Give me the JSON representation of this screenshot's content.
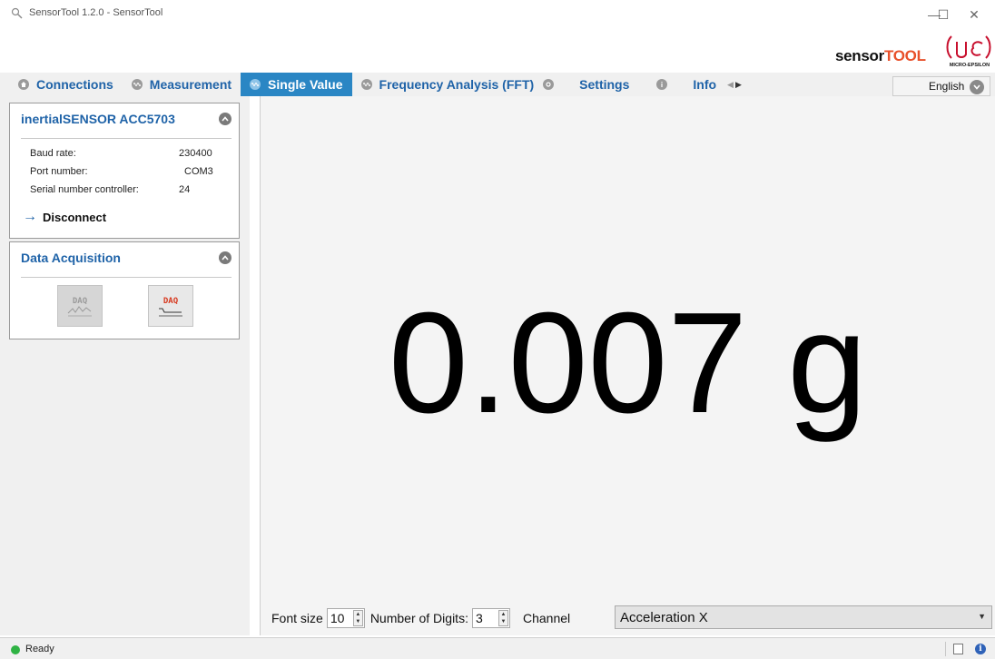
{
  "window": {
    "title": "SensorTool 1.2.0 - SensorTool",
    "minimize_glyph": "—",
    "maximize_glyph": "☐",
    "close_glyph": "✕"
  },
  "branding": {
    "sensor": "sensor",
    "tool": "TOOL",
    "company": "MICRO-EPSILON"
  },
  "tabs": [
    {
      "label": "Connections",
      "icon": "home-icon",
      "active": false
    },
    {
      "label": "Measurement",
      "icon": "wave-icon",
      "active": false
    },
    {
      "label": "Single Value",
      "icon": "wave-icon",
      "active": true
    },
    {
      "label": "Frequency Analysis (FFT)",
      "icon": "wave-icon",
      "active": false
    },
    {
      "label": "Settings",
      "icon": "gear-icon",
      "active": false
    },
    {
      "label": "Info",
      "icon": "info-icon",
      "active": false
    }
  ],
  "language": {
    "selected": "English"
  },
  "device": {
    "title": "inertialSENSOR ACC5703",
    "properties": [
      {
        "label": "Baud rate:",
        "value": "230400"
      },
      {
        "label": "Port number:",
        "value": "COM3"
      },
      {
        "label": "Serial number controller:",
        "value": "24"
      }
    ],
    "action": "Disconnect"
  },
  "acquisition": {
    "title": "Data Acquisition",
    "buttons": [
      {
        "label": "DAQ",
        "state": "disabled"
      },
      {
        "label": "DAQ",
        "state": "enabled"
      }
    ]
  },
  "measurement": {
    "display": "0.007 g"
  },
  "controls": {
    "font_size_label": "Font size",
    "font_size_value": "10",
    "digits_label": "Number of Digits:",
    "digits_value": "3",
    "channel_label": "Channel",
    "channel_value": "Acceleration X"
  },
  "status": {
    "text": "Ready",
    "color": "#2fb344"
  },
  "colors": {
    "accent": "#2a86c4",
    "tab_text": "#1f63a8",
    "brand_orange": "#e8512b",
    "logo_red": "#c8102e"
  }
}
